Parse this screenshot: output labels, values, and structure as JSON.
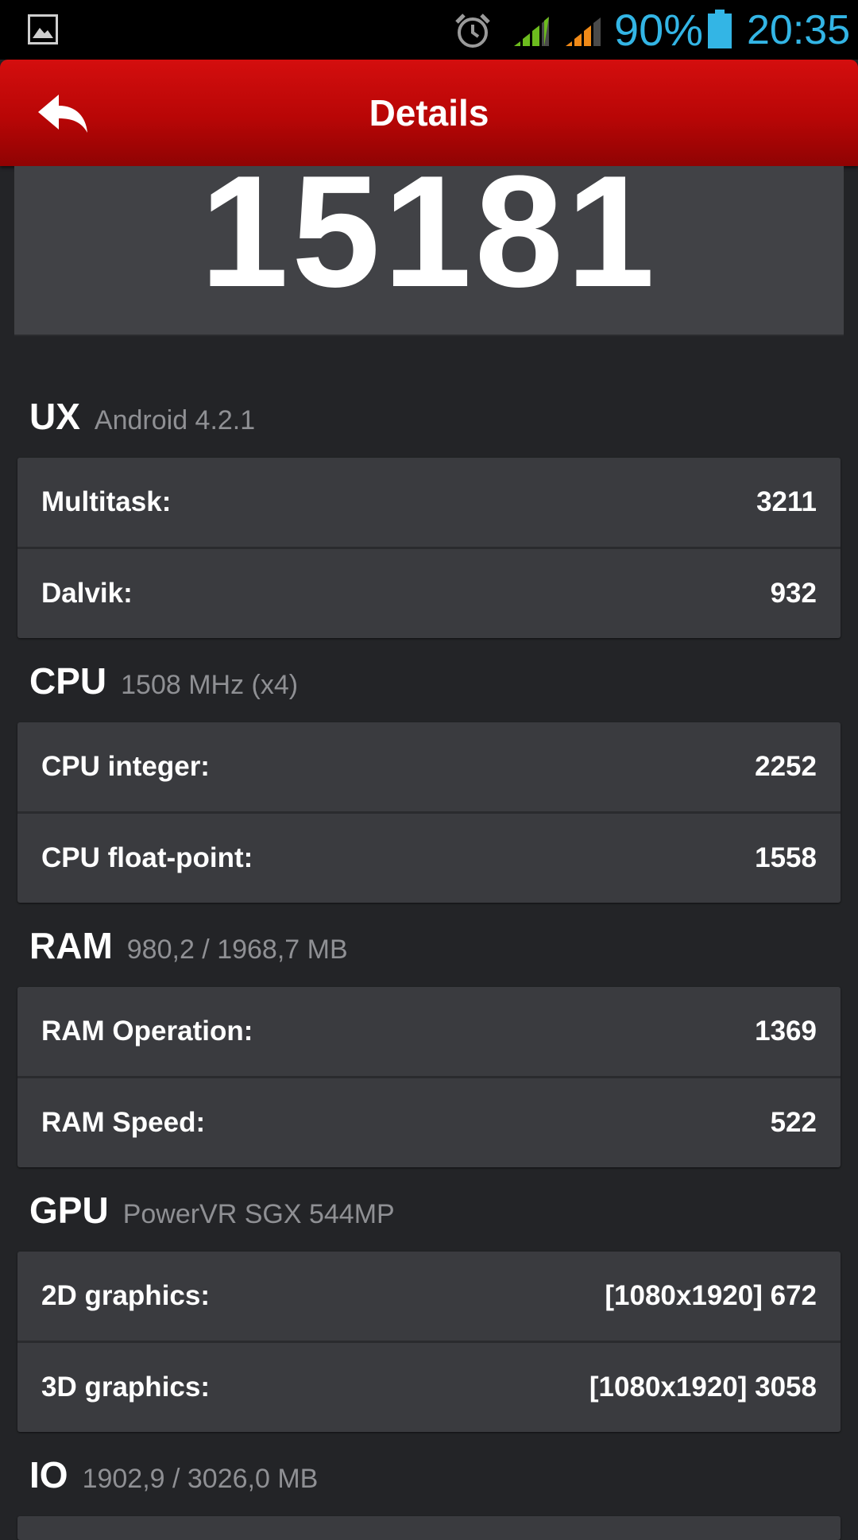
{
  "status_bar": {
    "battery_percent": "90%",
    "time": "20:35",
    "icons": [
      "gallery-notification-icon",
      "alarm-icon",
      "signal-icon",
      "signal-icon",
      "battery-icon"
    ],
    "accent_color": "#33b5e5"
  },
  "action_bar": {
    "title": "Details",
    "back_icon": "back-arrow-icon",
    "color": "#c00a0a"
  },
  "score": "15181",
  "sections": [
    {
      "name": "UX",
      "subtitle": "Android 4.2.1",
      "rows": [
        {
          "label": "Multitask:",
          "value": "3211"
        },
        {
          "label": "Dalvik:",
          "value": "932"
        }
      ]
    },
    {
      "name": "CPU",
      "subtitle": "1508 MHz (x4)",
      "rows": [
        {
          "label": "CPU integer:",
          "value": "2252"
        },
        {
          "label": "CPU float-point:",
          "value": "1558"
        }
      ]
    },
    {
      "name": "RAM",
      "subtitle": "980,2 / 1968,7 MB",
      "rows": [
        {
          "label": "RAM Operation:",
          "value": "1369"
        },
        {
          "label": "RAM Speed:",
          "value": "522"
        }
      ]
    },
    {
      "name": "GPU",
      "subtitle": "PowerVR SGX 544MP",
      "rows": [
        {
          "label": "2D graphics:",
          "value": "[1080x1920] 672"
        },
        {
          "label": "3D graphics:",
          "value": "[1080x1920] 3058"
        }
      ]
    },
    {
      "name": "IO",
      "subtitle": "1902,9 / 3026,0 MB",
      "rows": []
    }
  ]
}
